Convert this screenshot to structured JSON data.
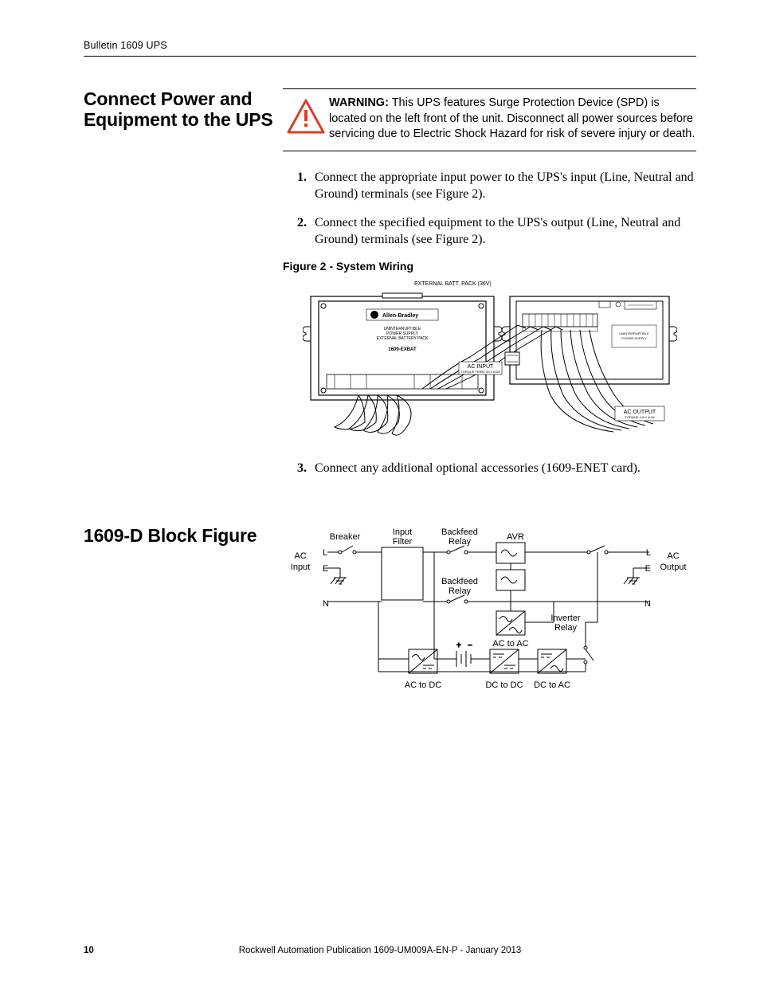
{
  "header": {
    "running": "Bulletin 1609 UPS"
  },
  "section1": {
    "heading_l1": "Connect Power and",
    "heading_l2": "Equipment to the UPS",
    "warning_label": "WARNING:",
    "warning_text": " This UPS features Surge Protection Device (SPD) is located on the left front of the unit. Disconnect all power sources before servicing due to Electric Shock Hazard for risk of severe injury or death.",
    "step1": "Connect the appropriate input power to the UPS's input (Line, Neutral and Ground) terminals (see Figure 2).",
    "step2": "Connect the specified equipment to the UPS's output (Line, Neutral and Ground) terminals (see Figure 2).",
    "fig2_caption": "Figure 2 - System Wiring",
    "fig2_labels": {
      "ext_batt": "EXTERNAL BATT. PACK (36V)",
      "brand": "Allen-Bradley",
      "unit_l1": "UNINTERRUPTIBLE",
      "unit_l2": "POWER SUPPLY",
      "unit_l3": "EXTERNAL BATTERY PACK",
      "model": "1609-EXBAT",
      "ac_in": "AC INPUT",
      "ac_in_sub": "TORQUE TERM. 20.0 in-lbf",
      "ac_out": "AC OUTPUT",
      "ac_out_sub": "TORQUE 4-8.0 in-lbf"
    },
    "step3": "Connect any additional optional accessories (1609-ENET card)."
  },
  "section2": {
    "heading": "1609-D Block Figure",
    "labels": {
      "breaker": "Breaker",
      "input_filter1": "Input",
      "input_filter2": "Filter",
      "backfeed1": "Backfeed",
      "relay": "Relay",
      "avr": "AVR",
      "ac": "AC",
      "input": "Input",
      "output": "Output",
      "L": "L",
      "E": "E",
      "N": "N",
      "ac_to_ac": "AC to AC",
      "ac_to_dc": "AC to DC",
      "dc_to_dc": "DC to DC",
      "dc_to_ac": "DC to AC",
      "inverter1": "Inverter",
      "inverter2": "Relay"
    }
  },
  "footer": {
    "page": "10",
    "pub": "Rockwell Automation Publication 1609-UM009A-EN-P - January 2013"
  }
}
